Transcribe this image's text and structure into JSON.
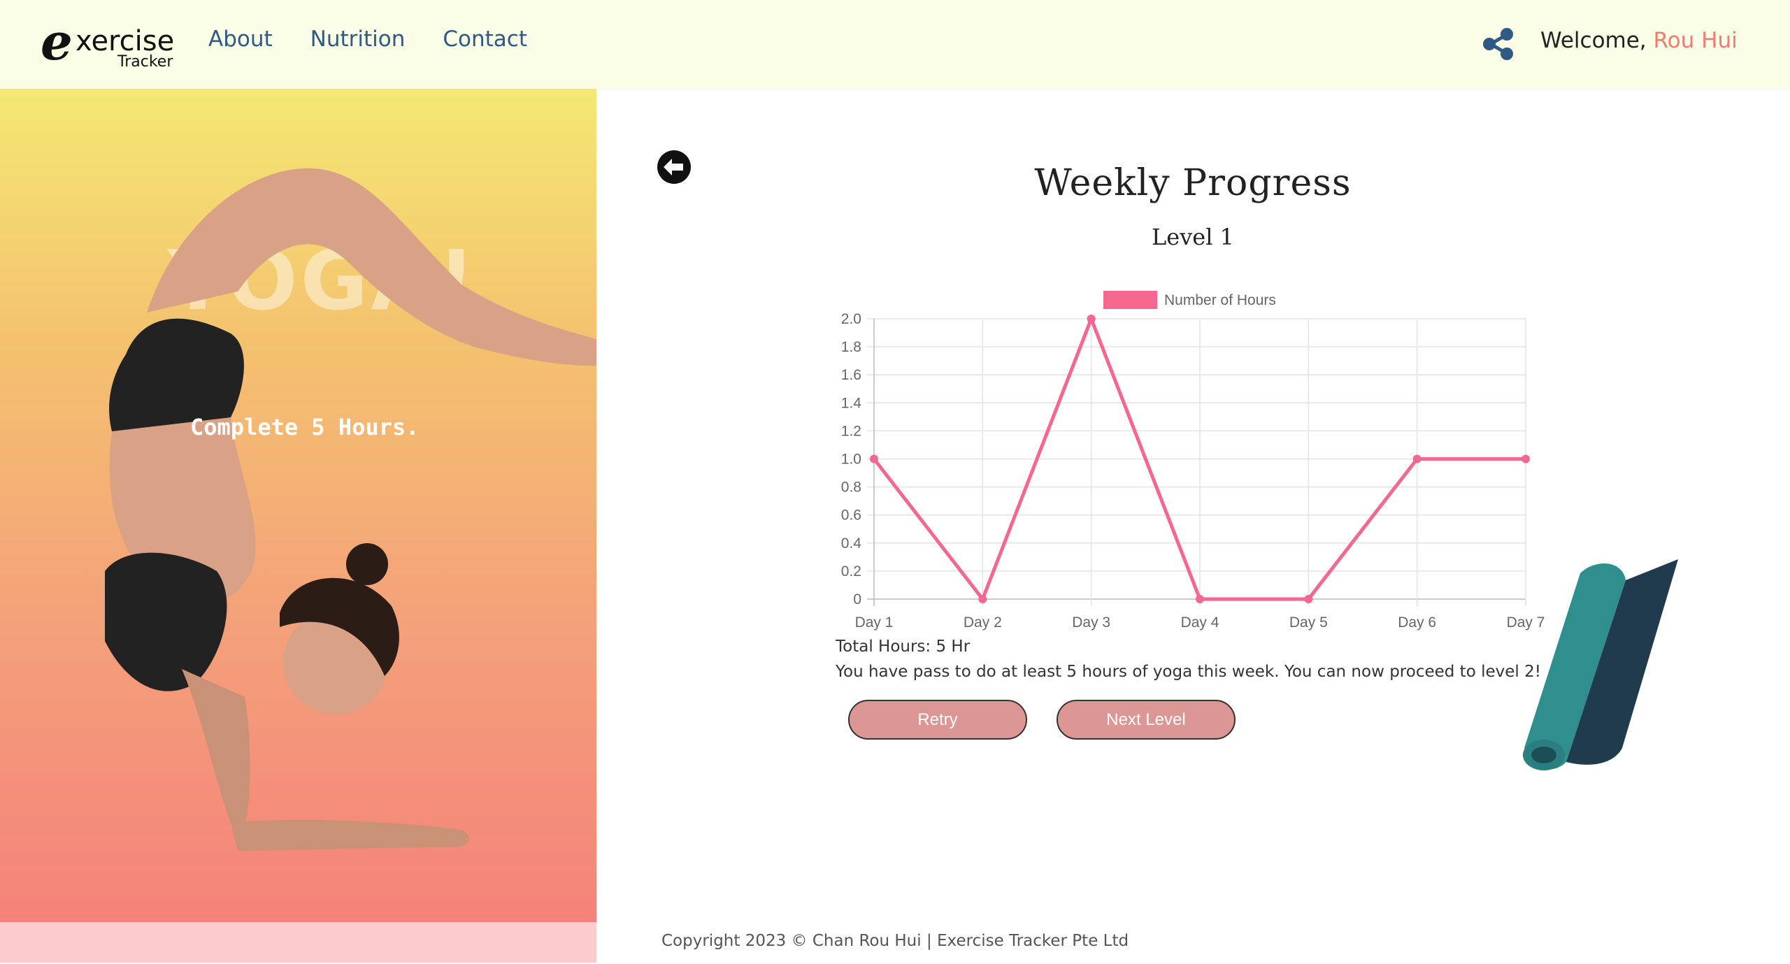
{
  "header": {
    "logo_letter": "e",
    "logo_word": "xercise",
    "logo_sub": "Tracker",
    "nav": [
      {
        "label": "About"
      },
      {
        "label": "Nutrition"
      },
      {
        "label": "Contact"
      }
    ],
    "share_icon": "share-icon",
    "welcome_label": "Welcome,",
    "user_name": "Rou Hui"
  },
  "hero": {
    "word": "YOGA!",
    "caption": "Complete 5 Hours."
  },
  "main": {
    "back_icon": "arrow-left-circle-icon",
    "title": "Weekly Progress",
    "subtitle": "Level 1",
    "total": "Total Hours: 5 Hr",
    "message": "You have pass to do at least 5 hours of yoga this week. You can now proceed to level 2!",
    "retry_label": "Retry",
    "next_label": "Next Level"
  },
  "chart_data": {
    "type": "line",
    "categories": [
      "Day 1",
      "Day 2",
      "Day 3",
      "Day 4",
      "Day 5",
      "Day 6",
      "Day 7"
    ],
    "series": [
      {
        "name": "Number of Hours",
        "values": [
          1.0,
          0,
          2.0,
          0,
          0,
          1.0,
          1.0
        ],
        "color": "#f5678e"
      }
    ],
    "yticks": [
      "0",
      "0.2",
      "0.4",
      "0.6",
      "0.8",
      "1.0",
      "1.2",
      "1.4",
      "1.6",
      "1.8",
      "2.0"
    ],
    "ylim": [
      0,
      2.0
    ],
    "grid": true,
    "legend": "top-center"
  },
  "colors": {
    "header_bg": "#fbfee6",
    "nav": "#2e5a84",
    "accent_name": "#f27b72",
    "button": "#dc9694",
    "line": "#f5678e"
  },
  "footer": {
    "text": "Copyright 2023 © Chan Rou Hui | Exercise Tracker Pte Ltd"
  }
}
